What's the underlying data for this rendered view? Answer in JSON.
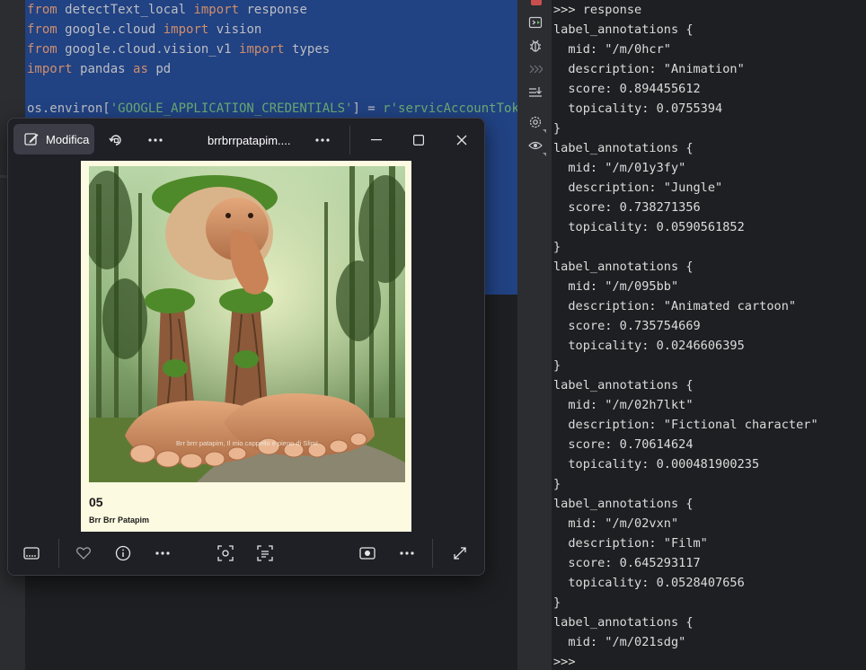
{
  "editor": {
    "lines": [
      {
        "parts": [
          {
            "t": "from ",
            "c": "kw"
          },
          {
            "t": "detectText_local ",
            "c": ""
          },
          {
            "t": "import ",
            "c": "kw"
          },
          {
            "t": "response",
            "c": ""
          }
        ]
      },
      {
        "parts": [
          {
            "t": "from ",
            "c": "kw"
          },
          {
            "t": "google.cloud ",
            "c": ""
          },
          {
            "t": "import ",
            "c": "kw"
          },
          {
            "t": "vision",
            "c": ""
          }
        ]
      },
      {
        "parts": [
          {
            "t": "from ",
            "c": "kw"
          },
          {
            "t": "google.cloud.vision_v1 ",
            "c": ""
          },
          {
            "t": "import ",
            "c": "kw"
          },
          {
            "t": "types",
            "c": ""
          }
        ]
      },
      {
        "parts": [
          {
            "t": "import ",
            "c": "kw"
          },
          {
            "t": "pandas ",
            "c": ""
          },
          {
            "t": "as ",
            "c": "kw"
          },
          {
            "t": "pd",
            "c": ""
          }
        ]
      },
      {
        "parts": []
      },
      {
        "parts": [
          {
            "t": "os.environ[",
            "c": ""
          },
          {
            "t": "'GOOGLE_APPLICATION_CREDENTIALS'",
            "c": "str"
          },
          {
            "t": "] = ",
            "c": ""
          },
          {
            "t": "r'servicAccountToken.j",
            "c": "str"
          }
        ]
      }
    ]
  },
  "toolstrip": {
    "icons": [
      "console-run-icon",
      "debug-icon",
      "forward-icon",
      "scroll-end-icon",
      "settings-icon",
      "view-icon"
    ]
  },
  "console": {
    "lines": [
      ">>> response",
      "label_annotations {",
      "  mid: \"/m/0hcr\"",
      "  description: \"Animation\"",
      "  score: 0.894455612",
      "  topicality: 0.0755394",
      "}",
      "label_annotations {",
      "  mid: \"/m/01y3fy\"",
      "  description: \"Jungle\"",
      "  score: 0.738271356",
      "  topicality: 0.0590561852",
      "}",
      "label_annotations {",
      "  mid: \"/m/095bb\"",
      "  description: \"Animated cartoon\"",
      "  score: 0.735754669",
      "  topicality: 0.0246606395",
      "}",
      "label_annotations {",
      "  mid: \"/m/02h7lkt\"",
      "  description: \"Fictional character\"",
      "  score: 0.70614624",
      "  topicality: 0.000481900235",
      "}",
      "label_annotations {",
      "  mid: \"/m/02vxn\"",
      "  description: \"Film\"",
      "  score: 0.645293117",
      "  topicality: 0.0528407656",
      "}",
      "label_annotations {",
      "  mid: \"/m/021sdg\"",
      ">>>"
    ]
  },
  "photos": {
    "edit_label": "Modifica",
    "title": "brrbrrpatapim....",
    "card": {
      "number": "05",
      "name": "Brr Brr Patapim",
      "image_caption": "Brr brrr patapim, Il mio cappello è pieno di Slim!"
    },
    "toolbar_icons": [
      "edit-icon",
      "rotate-icon",
      "more-icon",
      "more-icon",
      "minimize-icon",
      "maximize-icon",
      "close-icon"
    ],
    "bottom_icons": [
      "filmstrip-icon",
      "heart-icon",
      "info-icon",
      "more-icon",
      "visual-search-icon",
      "text-scan-icon",
      "slideshow-icon",
      "more-icon",
      "fullscreen-icon"
    ]
  },
  "colors": {
    "selection": "#214283",
    "keyword": "#cf8e6d",
    "string": "#6aab73",
    "console_text": "#dcdcdc",
    "card_bg": "#fcfae0"
  }
}
